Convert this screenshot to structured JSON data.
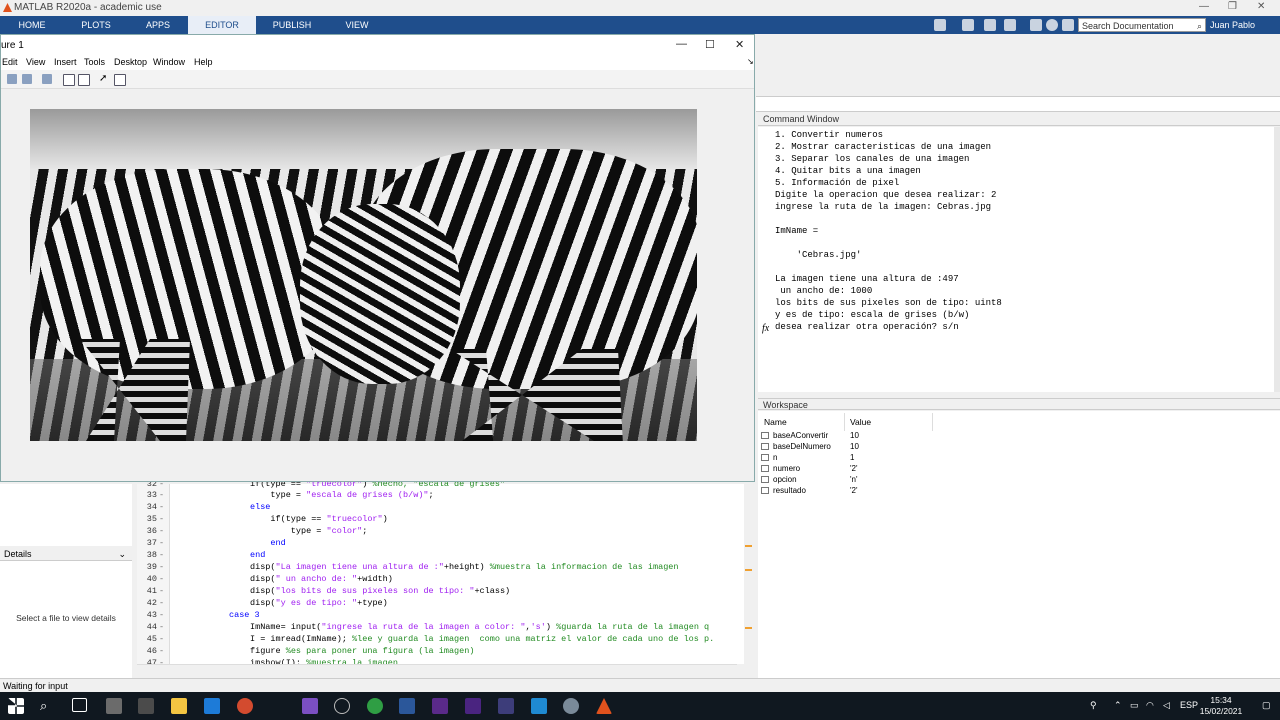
{
  "app": {
    "title": "MATLAB R2020a - academic use",
    "ribbon_tabs": [
      "HOME",
      "PLOTS",
      "APPS",
      "EDITOR",
      "PUBLISH",
      "VIEW"
    ],
    "active_tab": "EDITOR",
    "search_placeholder": "Search Documentation",
    "user": "Juan Pablo"
  },
  "figure": {
    "title": "ure 1",
    "menu": [
      "Edit",
      "View",
      "Insert",
      "Tools",
      "Desktop",
      "Window",
      "Help"
    ]
  },
  "command_window": {
    "title": "Command Window",
    "lines": [
      "1. Convertir numeros",
      "2. Mostrar caracteristicas de una imagen",
      "3. Separar los canales de una imagen",
      "4. Quitar bits a una imagen",
      "5. Información de pixel",
      "Digite la operacion que desea realizar: 2",
      "ingrese la ruta de la imagen: Cebras.jpg",
      "",
      "ImName =",
      "",
      "    'Cebras.jpg'",
      "",
      "La imagen tiene una altura de :497",
      " un ancho de: 1000",
      "los bits de sus pixeles son de tipo: uint8",
      "y es de tipo: escala de grises (b/w)",
      "desea realizar otra operación? s/n"
    ],
    "prompt": "fx"
  },
  "workspace": {
    "title": "Workspace",
    "columns": [
      "Name",
      "Value"
    ],
    "rows": [
      {
        "name": "baseAConvertir",
        "value": "10"
      },
      {
        "name": "baseDelNumero",
        "value": "10"
      },
      {
        "name": "n",
        "value": "1"
      },
      {
        "name": "numero",
        "value": "'2'"
      },
      {
        "name": "opcion",
        "value": "'n'"
      },
      {
        "name": "resultado",
        "value": "'2'"
      }
    ]
  },
  "details": {
    "title": "Details",
    "message": "Select a file to view details"
  },
  "editor": {
    "lines": [
      {
        "n": "32",
        "code": "if(type == \"truecolor\") %hecho, \"escala de grises\""
      },
      {
        "n": "33",
        "code": "    type = \"escala de grises (b/w)\";"
      },
      {
        "n": "34",
        "code": "else"
      },
      {
        "n": "35",
        "code": "    if(type == \"truecolor\")"
      },
      {
        "n": "36",
        "code": "        type = \"color\";"
      },
      {
        "n": "37",
        "code": "    end"
      },
      {
        "n": "38",
        "code": "end"
      },
      {
        "n": "39",
        "code": "disp(\"La imagen tiene una altura de :\"+height) %muestra la informacion de las imagen"
      },
      {
        "n": "40",
        "code": "disp(\" un ancho de: \"+width)"
      },
      {
        "n": "41",
        "code": "disp(\"los bits de sus pixeles son de tipo: \"+class)"
      },
      {
        "n": "42",
        "code": "disp(\"y es de tipo: \"+type)"
      },
      {
        "n": "43",
        "code": "case 3"
      },
      {
        "n": "44",
        "code": "ImName= input(\"ingrese la ruta de la imagen a color: \",'s') %guarda la ruta de la imagen q"
      },
      {
        "n": "45",
        "code": "I = imread(ImName); %lee y guarda la imagen  como una matriz el valor de cada uno de los p."
      },
      {
        "n": "46",
        "code": "figure %es para poner una figura (la imagen)"
      },
      {
        "n": "47",
        "code": "imshow(I); %muestra la imagen"
      }
    ]
  },
  "status": {
    "text": "Waiting for input"
  },
  "taskbar": {
    "time": "15:34",
    "date": "15/02/2021",
    "lang": "ESP"
  }
}
